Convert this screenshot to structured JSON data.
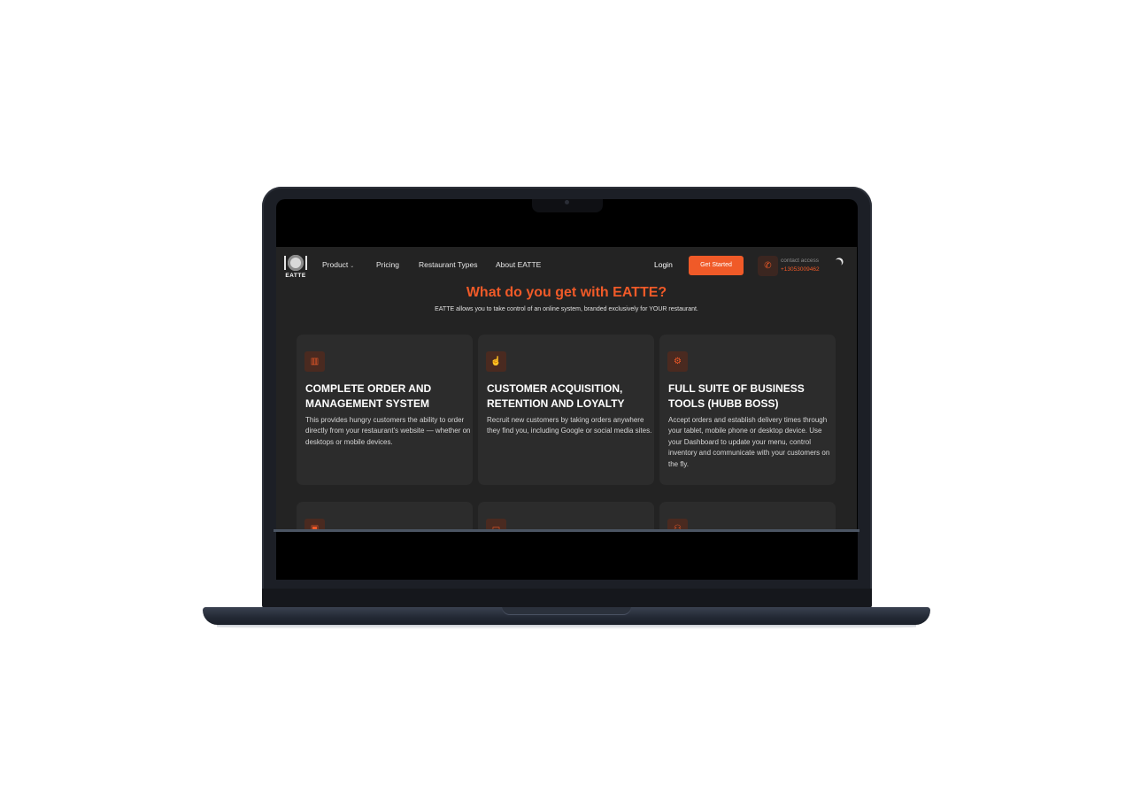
{
  "nav": {
    "logo_text": "EATTE",
    "links": [
      {
        "label": "Product",
        "has_dropdown": true
      },
      {
        "label": "Pricing"
      },
      {
        "label": "Restaurant Types"
      },
      {
        "label": "About EATTE"
      }
    ],
    "login_label": "Login",
    "cta_label": "Get Started",
    "contact_label": "contact access",
    "contact_phone": "+13053009462"
  },
  "hero": {
    "title": "What do you get with EATTE?",
    "subtitle": "EATTE allows you to take control of an online system, branded exclusively for YOUR restaurant."
  },
  "cards": [
    {
      "icon": "chart-icon",
      "title": "COMPLETE ORDER AND MANAGEMENT SYSTEM",
      "text": "This provides hungry customers the ability to order directly from your restaurant's website — whether on desktops or mobile devices."
    },
    {
      "icon": "hand-pointer-icon",
      "title": "CUSTOMER ACQUISITION, RETENTION AND LOYALTY",
      "text": "Recruit new customers by taking orders anywhere they find you, including Google or social media sites."
    },
    {
      "icon": "gear-icon",
      "title": "FULL SUITE OF BUSINESS TOOLS (HUBB BOSS)",
      "text": "Accept orders and establish delivery times through your tablet, mobile phone or desktop device. Use your Dashboard to update your menu, control inventory and communicate with your customers on the fly."
    }
  ],
  "cards_row2_icons": [
    "play-icon",
    "card-icon",
    "group-icon"
  ],
  "colors": {
    "accent": "#f05a28",
    "page_bg": "#232323",
    "card_bg": "#2c2c2c",
    "bezel": "#1c1f26"
  }
}
